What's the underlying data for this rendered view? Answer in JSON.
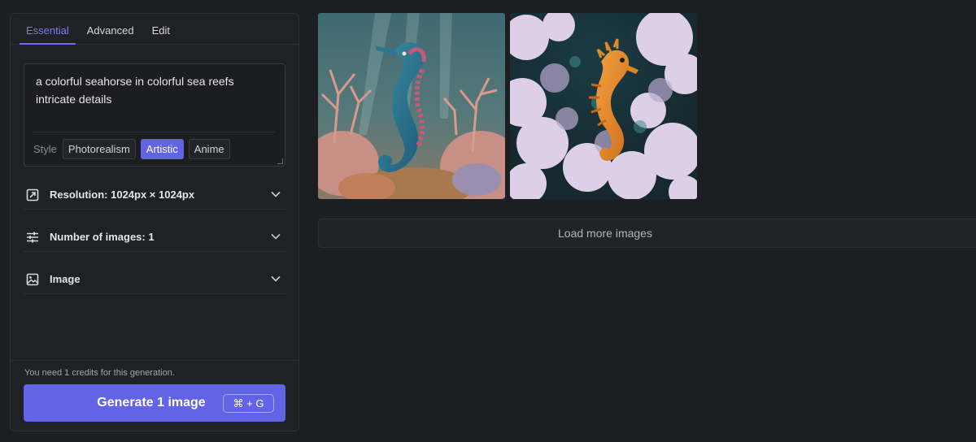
{
  "tabs": [
    {
      "label": "Essential",
      "active": true
    },
    {
      "label": "Advanced",
      "active": false
    },
    {
      "label": "Edit",
      "active": false
    }
  ],
  "prompt": {
    "text": "a colorful seahorse in colorful sea reefs intricate details"
  },
  "style": {
    "label": "Style",
    "options": [
      "Photorealism",
      "Artistic",
      "Anime"
    ],
    "selected": "Artistic"
  },
  "options": {
    "resolution": {
      "label": "Resolution: 1024px × 1024px",
      "icon": "resize-icon"
    },
    "num_images": {
      "label": "Number of images: 1",
      "icon": "sliders-icon"
    },
    "image": {
      "label": "Image",
      "icon": "image-icon"
    }
  },
  "footer": {
    "credits_note": "You need 1 credits for this generation.",
    "generate_label": "Generate 1 image",
    "shortcut": "⌘ + G"
  },
  "gallery": {
    "images": [
      {
        "subject": "blue-teal seahorse among pink coral reef",
        "icon": "generated-image"
      },
      {
        "subject": "orange seahorse among white-lilac coral",
        "icon": "generated-image"
      }
    ],
    "load_more_label": "Load more images"
  },
  "colors": {
    "accent": "#6264e6",
    "background": "#1d1e22",
    "panel": "#202125"
  }
}
